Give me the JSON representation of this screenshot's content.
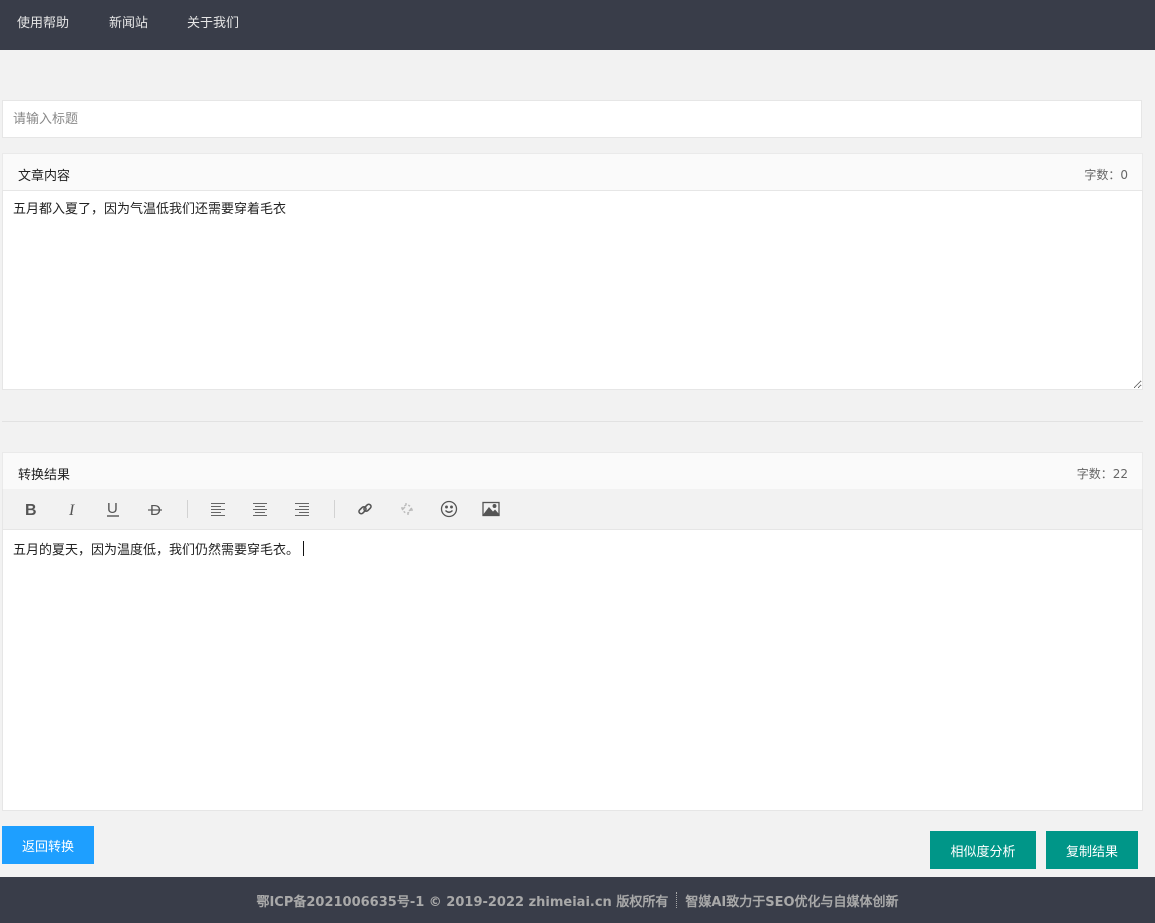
{
  "nav": {
    "items": [
      {
        "label": "使用帮助"
      },
      {
        "label": "新闻站"
      },
      {
        "label": "关于我们"
      }
    ]
  },
  "title_input": {
    "placeholder": "请输入标题",
    "value": ""
  },
  "article": {
    "label": "文章内容",
    "count_label": "字数：0",
    "text": "五月都入夏了，因为气温低我们还需要穿着毛衣"
  },
  "result": {
    "label": "转换结果",
    "count_label": "字数：22",
    "text": "五月的夏天，因为温度低，我们仍然需要穿毛衣。"
  },
  "toolbar": {
    "icons": [
      "bold-icon",
      "italic-icon",
      "underline-icon",
      "strikethrough-icon",
      "align-left-icon",
      "align-center-icon",
      "align-right-icon",
      "link-icon",
      "unlink-icon",
      "emoji-icon",
      "image-icon"
    ]
  },
  "buttons": {
    "back": "返回转换",
    "similarity": "相似度分析",
    "copy": "复制结果"
  },
  "footer": {
    "copyright": "鄂ICP备2021006635号-1 © 2019-2022 zhimeiai.cn 版权所有",
    "slogan": "智媒AI致力于SEO优化与自媒体创新"
  },
  "colors": {
    "nav_bg": "#393d49",
    "primary_blue": "#1e9fff",
    "primary_teal": "#009688",
    "page_bg": "#f2f2f2"
  }
}
